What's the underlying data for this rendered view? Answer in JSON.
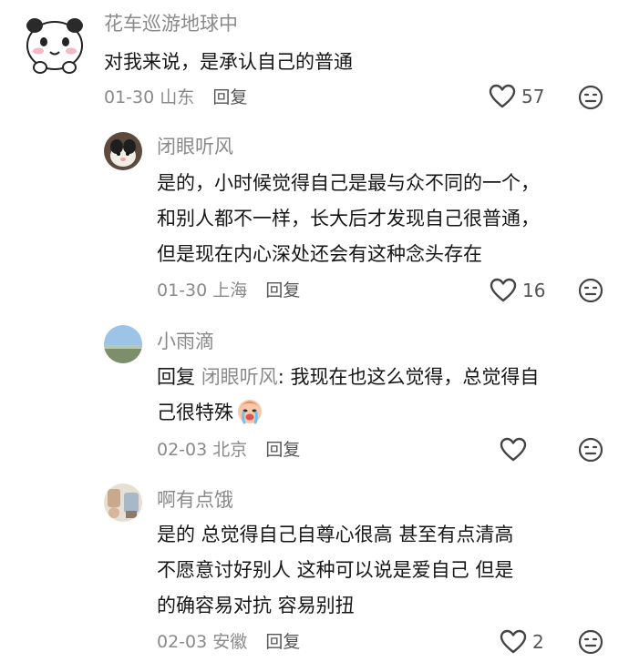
{
  "comments": [
    {
      "username": "花车巡游地球中",
      "lines": [
        "对我来说，是承认自己的普通"
      ],
      "date": "01-30",
      "location": "山东",
      "reply_label": "回复",
      "likes": "57"
    },
    {
      "username": "闭眼听风",
      "lines": [
        "是的，小时候觉得自己是最与众不同的一个，",
        "和别人都不一样，长大后才发现自己很普通，",
        "但是现在内心深处还会有这种念头存在"
      ],
      "date": "01-30",
      "location": "上海",
      "reply_label": "回复",
      "likes": "16"
    },
    {
      "username": "小雨滴",
      "reply_prefix": "回复",
      "reply_to": "闭眼听风",
      "reply_rest": ": 我现在也这么觉得，总觉得自",
      "line2": "己很特殊",
      "date": "02-03",
      "location": "北京",
      "reply_label": "回复",
      "likes": ""
    },
    {
      "username": "啊有点饿",
      "lines": [
        "是的  总觉得自己自尊心很高  甚至有点清高",
        "不愿意讨好别人  这种可以说是爱自己   但是",
        "的确容易对抗   容易别扭"
      ],
      "date": "02-03",
      "location": "安徽",
      "reply_label": "回复",
      "likes": "2"
    }
  ],
  "icons": {
    "like": "heart-outline-icon",
    "dislike": "frown-face-icon",
    "crying_emoji": "crying-face-emoji"
  }
}
